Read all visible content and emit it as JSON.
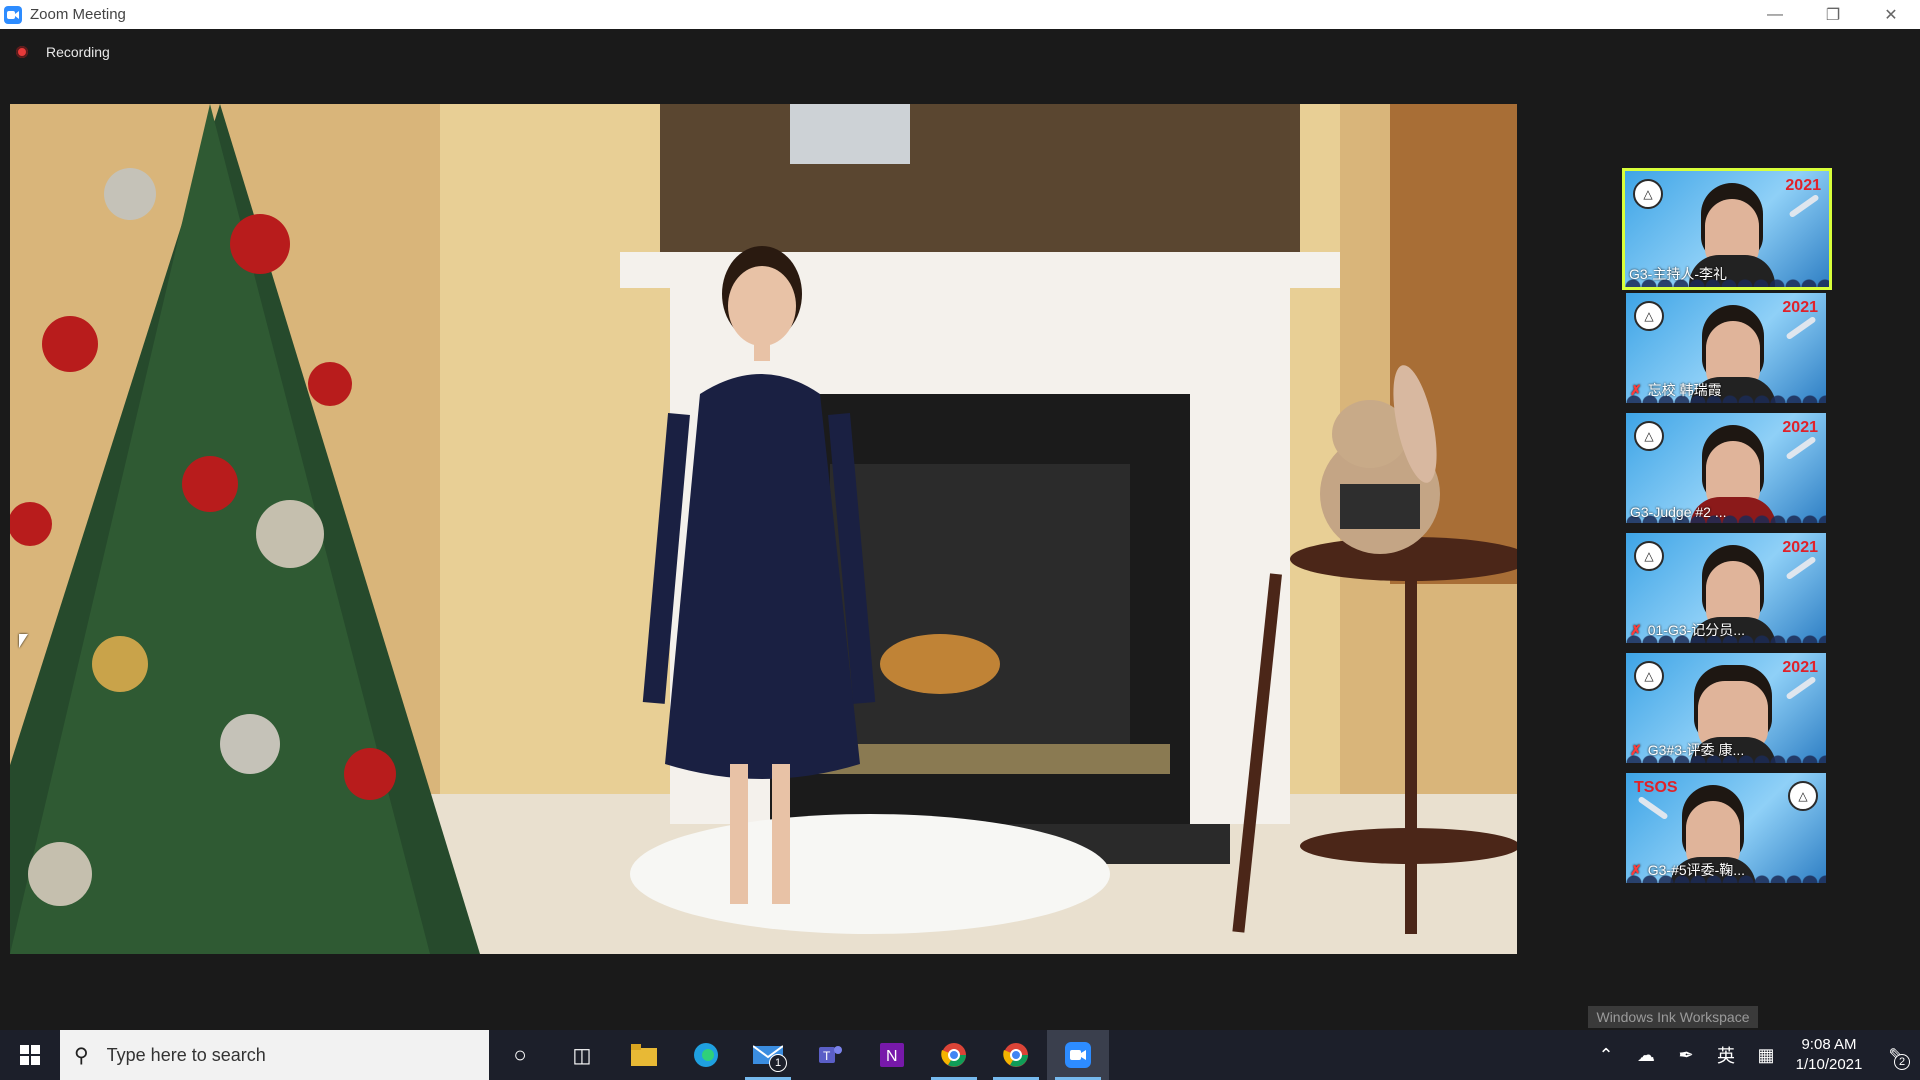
{
  "window": {
    "title": "Zoom Meeting",
    "controls": [
      "minimize",
      "restore",
      "close"
    ]
  },
  "recording": {
    "label": "Recording",
    "color": "#e63a3a"
  },
  "gallery": {
    "active_speaker_border_color": "#d8ff3a",
    "participants": [
      {
        "name": "G3-主持人-李礼",
        "muted": false,
        "speaking": true
      },
      {
        "name": "忘校 韩瑞霞",
        "muted": true,
        "speaking": false
      },
      {
        "name": "G3-Judge #2 ...",
        "muted": false,
        "speaking": false
      },
      {
        "name": "01-G3-记分员...",
        "muted": true,
        "speaking": false
      },
      {
        "name": "G3#3-评委 康...",
        "muted": true,
        "speaking": false
      },
      {
        "name": "G3-#5评委-鞠...",
        "muted": true,
        "speaking": false
      }
    ],
    "tile_year": "2021",
    "last_tile_year": "TSOS"
  },
  "tooltip": {
    "text": "Windows Ink Workspace"
  },
  "taskbar": {
    "search_placeholder": "Type here to search",
    "apps": [
      {
        "name": "cortana",
        "icon": "○"
      },
      {
        "name": "task-view",
        "icon": "⧉"
      },
      {
        "name": "file-explorer",
        "icon": "📁"
      },
      {
        "name": "edge",
        "icon": "e"
      },
      {
        "name": "mail",
        "icon": "✉",
        "badge": "1"
      },
      {
        "name": "teams",
        "icon": "T"
      },
      {
        "name": "onenote",
        "icon": "N"
      },
      {
        "name": "chrome-1",
        "icon": "◉"
      },
      {
        "name": "chrome-2",
        "icon": "◉"
      },
      {
        "name": "zoom",
        "icon": "▶"
      }
    ],
    "tray": {
      "input_language": "英",
      "time": "9:08 AM",
      "date": "1/10/2021",
      "notification_count": "2"
    }
  }
}
